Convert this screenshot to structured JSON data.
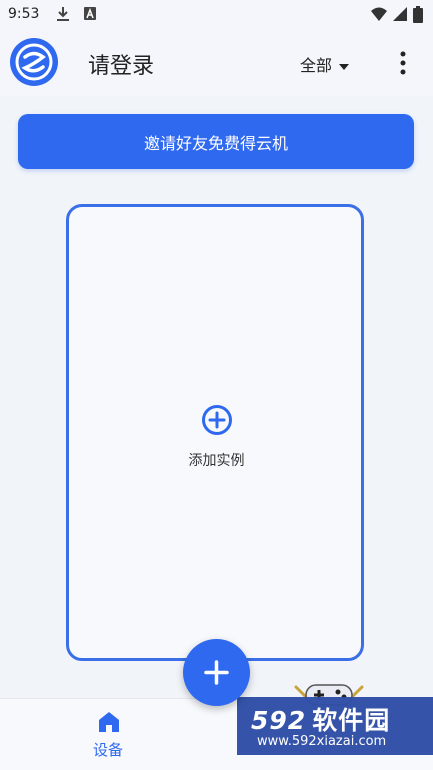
{
  "status_bar": {
    "time": "9:53"
  },
  "app_bar": {
    "title": "请登录",
    "filter_label": "全部"
  },
  "invite_button": {
    "label": "邀请好友免费得云机"
  },
  "instance_card": {
    "add_label": "添加实例"
  },
  "bottom_nav": {
    "items": [
      {
        "label": "设备",
        "icon": "home-icon",
        "active": true
      }
    ]
  },
  "watermark": {
    "brand_number": "592",
    "brand_text": "软件园",
    "url": "www.592xiazai.com"
  },
  "colors": {
    "accent": "#2f69f0",
    "card_border": "#3a6fe8",
    "background": "#f1f4f9"
  }
}
